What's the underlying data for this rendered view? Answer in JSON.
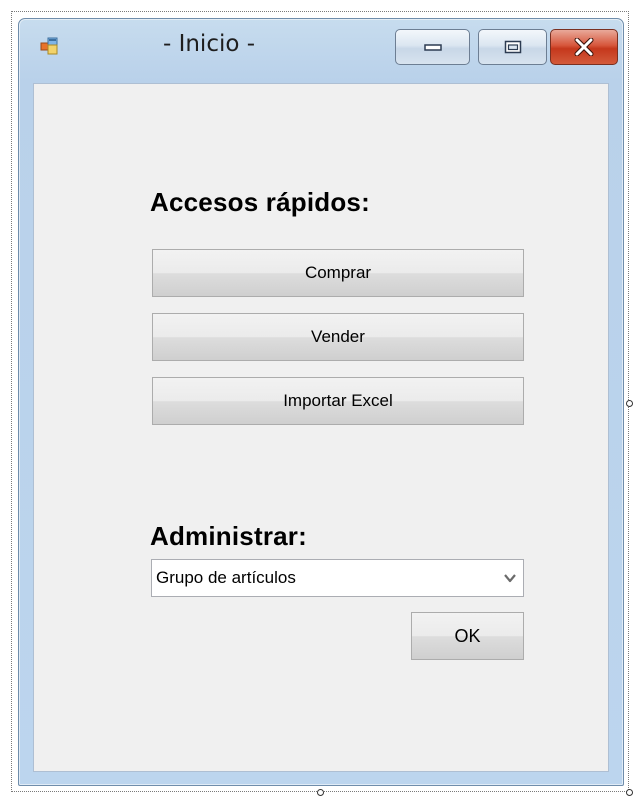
{
  "window": {
    "title": "- Inicio -",
    "icon": "app-form-icon",
    "caption_buttons": [
      "minimize-icon",
      "maximize-icon",
      "close-icon"
    ]
  },
  "quick_access": {
    "heading": "Accesos rápidos:",
    "buttons": [
      {
        "label": "Comprar"
      },
      {
        "label": "Vender"
      },
      {
        "label": "Importar Excel"
      }
    ]
  },
  "administrar": {
    "heading": "Administrar:",
    "select": {
      "value": "Grupo de artículos",
      "icon": "chevron-down-icon"
    },
    "ok_label": "OK"
  },
  "colors": {
    "window_frame": "#b9d1ea",
    "client_bg": "#f0f0f0",
    "close_button": "#c5381d"
  }
}
